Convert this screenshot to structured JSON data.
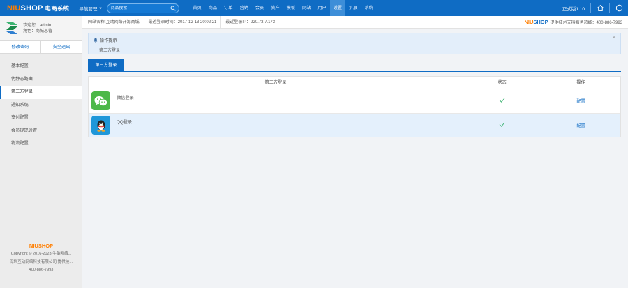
{
  "topbar": {
    "logo_prefix": "NIU",
    "logo_suffix": "SHOP",
    "logo_system": "电商系统",
    "quick_nav_label": "导航管理",
    "search_placeholder": "商品搜索",
    "nav": [
      "首页",
      "商品",
      "订单",
      "营销",
      "会员",
      "资产",
      "模板",
      "网站",
      "用户",
      "设置",
      "扩展",
      "系统"
    ],
    "active_nav": "设置",
    "version": "正式版1.10",
    "icons": [
      "home-icon",
      "help-icon"
    ]
  },
  "sidebar": {
    "welcome": "欢迎您：admin",
    "role": "角色：商城总管",
    "buttons": [
      "修改密码",
      "安全退出"
    ],
    "menu": [
      "基本配置",
      "伪静态路由",
      "第三方登录",
      "通知系统",
      "支付配置",
      "会员提现设置",
      "物流配置"
    ],
    "active_menu": "第三方登录",
    "footer_logo": "NIUSHOP",
    "footer_lines": [
      "Copyright © 2016-2023 牛酷网络...",
      "深圳互动网络科技有限公司 提供技...",
      "400-886-7993"
    ]
  },
  "infobar": {
    "segments": [
      "网站名称:互动网络开源商城",
      "最近登录时间：2017-12-13 20:02:21",
      "最近登录IP：220.73.7.173"
    ],
    "support_brand_prefix": "NIU",
    "support_brand_suffix": "SHOP",
    "support_text": "提供技术支持服务热线：400-886-7993"
  },
  "tips": {
    "title": "操作提示",
    "text": "第三方登录",
    "close": "×"
  },
  "tab": {
    "label": "第三方登录"
  },
  "table": {
    "headers": [
      "第三方登录",
      "状态",
      "操作"
    ],
    "rows": [
      {
        "name": "微信登录",
        "icon": "wechat-icon",
        "status": "✓",
        "action": "配置"
      },
      {
        "name": "QQ登录",
        "icon": "qq-icon",
        "status": "✓",
        "action": "配置"
      }
    ]
  },
  "colors": {
    "brand_blue": "#0f6cc4",
    "brand_orange": "#ff7e00",
    "wechat_green": "#4cb848",
    "qq_blue": "#1f97d9",
    "check_green": "#3cb371"
  }
}
